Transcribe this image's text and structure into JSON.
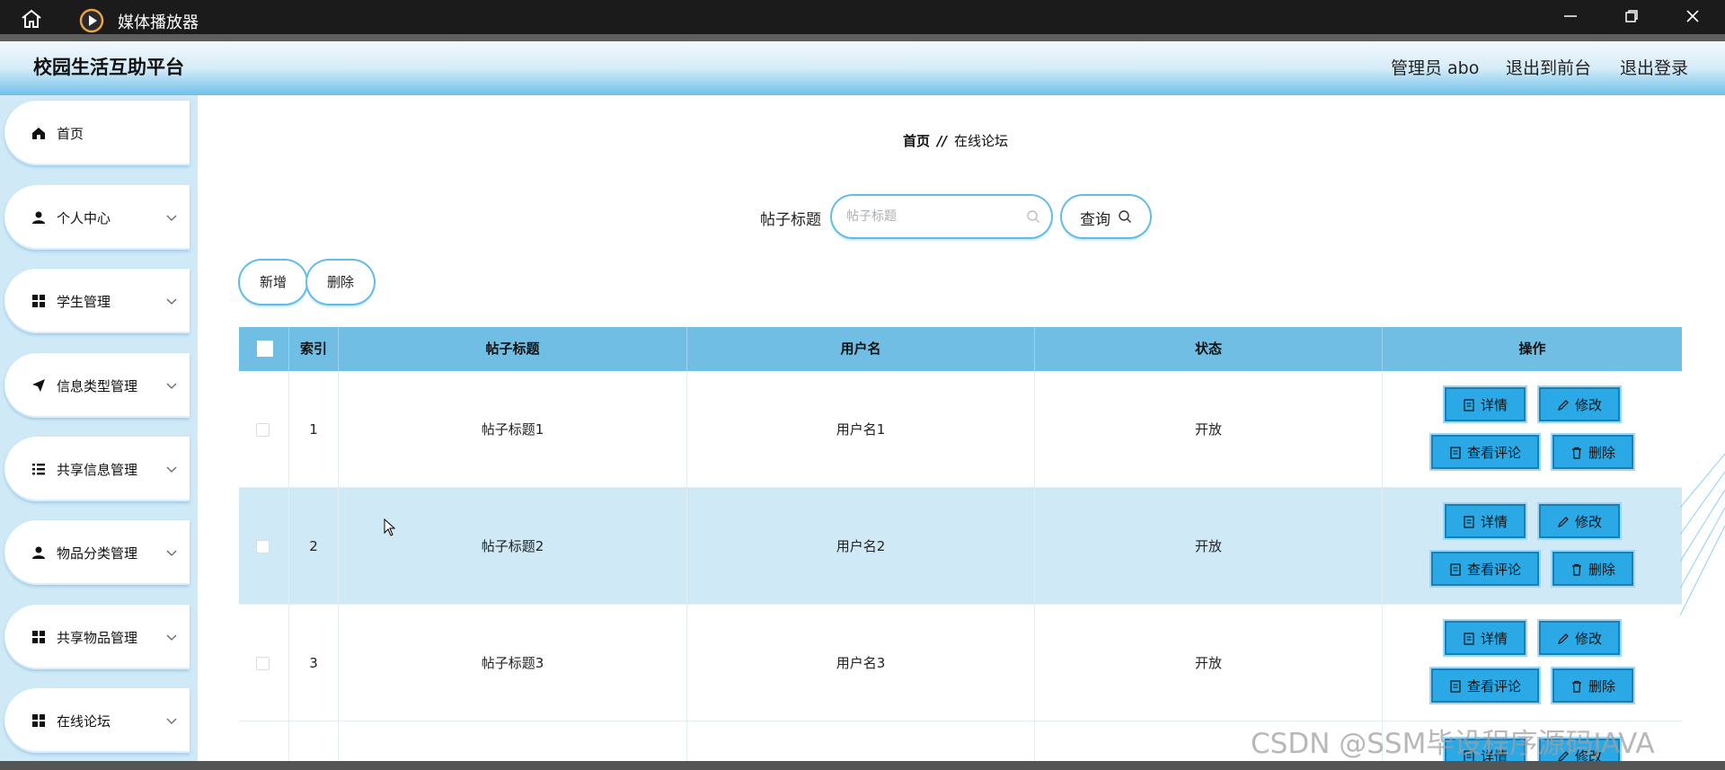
{
  "window": {
    "title": "媒体播放器"
  },
  "header": {
    "brand": "校园生活互助平台",
    "user": "管理员 abo",
    "to_front": "退出到前台",
    "logout": "退出登录"
  },
  "sidebar": {
    "items": [
      {
        "label": "首页",
        "icon": "home-icon"
      },
      {
        "label": "个人中心",
        "icon": "user-icon"
      },
      {
        "label": "学生管理",
        "icon": "grid-icon"
      },
      {
        "label": "信息类型管理",
        "icon": "paper-plane-icon"
      },
      {
        "label": "共享信息管理",
        "icon": "list-icon"
      },
      {
        "label": "物品分类管理",
        "icon": "user-icon"
      },
      {
        "label": "共享物品管理",
        "icon": "grid-icon"
      },
      {
        "label": "在线论坛",
        "icon": "grid-icon"
      }
    ]
  },
  "breadcrumb": {
    "home": "首页",
    "sep": "//",
    "current": "在线论坛"
  },
  "search": {
    "label": "帖子标题",
    "placeholder": "帖子标题",
    "button": "查询"
  },
  "toolbar": {
    "add": "新增",
    "delete": "删除"
  },
  "table": {
    "columns": [
      "索引",
      "帖子标题",
      "用户名",
      "状态",
      "操作"
    ],
    "rows": [
      {
        "index": "1",
        "title": "帖子标题1",
        "username": "用户名1",
        "status": "开放"
      },
      {
        "index": "2",
        "title": "帖子标题2",
        "username": "用户名2",
        "status": "开放"
      },
      {
        "index": "3",
        "title": "帖子标题3",
        "username": "用户名3",
        "status": "开放"
      }
    ],
    "actions": {
      "detail": "详情",
      "edit": "修改",
      "comments": "查看评论",
      "delete": "删除"
    }
  },
  "watermark": "CSDN @SSM毕设程序源码JAVA",
  "colors": {
    "accent": "#2aa9e6",
    "header_blue": "#71bee5",
    "sidebar_bg": "#cfe9f7"
  }
}
